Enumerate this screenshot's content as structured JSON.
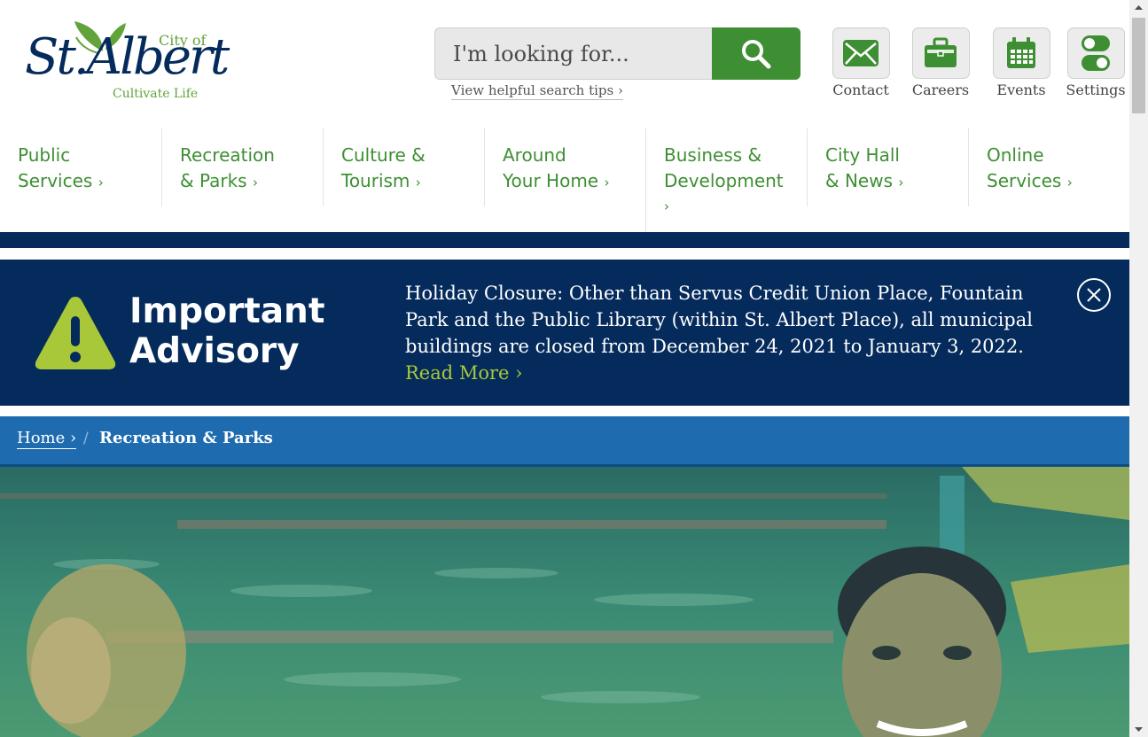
{
  "logo": {
    "city_of": "City of",
    "name": "St.Albert",
    "tagline": "Cultivate Life"
  },
  "search": {
    "placeholder": "I'm looking for...",
    "tips_label": "View helpful search tips ›"
  },
  "utility_nav": [
    {
      "label": "Contact",
      "icon": "envelope-icon"
    },
    {
      "label": "Careers",
      "icon": "briefcase-icon"
    },
    {
      "label": "Events",
      "icon": "calendar-icon"
    },
    {
      "label": "Settings",
      "icon": "toggle-icon"
    }
  ],
  "main_nav": [
    {
      "line1": "Public",
      "line2": "Services",
      "chevron": "›"
    },
    {
      "line1": "Recreation",
      "line2": "& Parks",
      "chevron": "›"
    },
    {
      "line1": "Culture &",
      "line2": "Tourism",
      "chevron": "›"
    },
    {
      "line1": "Around",
      "line2": "Your Home",
      "chevron": "›"
    },
    {
      "line1": "Business &",
      "line2": "Development",
      "line3": "›"
    },
    {
      "line1": "City Hall",
      "line2": "& News",
      "chevron": "›"
    },
    {
      "line1": "Online",
      "line2": "Services",
      "chevron": "›"
    }
  ],
  "advisory": {
    "title_line1": "Important",
    "title_line2": "Advisory",
    "message": "Holiday Closure: Other than Servus Credit Union Place, Fountain Park and the Public Library (within St. Albert Place), all municipal buildings are closed from December 24, 2021 to January 3, 2022.",
    "read_more": "Read More ›"
  },
  "breadcrumb": {
    "home": "Home ›",
    "separator": "/",
    "current": "Recreation & Parks"
  },
  "colors": {
    "brand_navy": "#052b5c",
    "brand_green": "#3e8f33",
    "accent_lime": "#a8c83a",
    "breadcrumb_blue": "#1f6bb0"
  }
}
